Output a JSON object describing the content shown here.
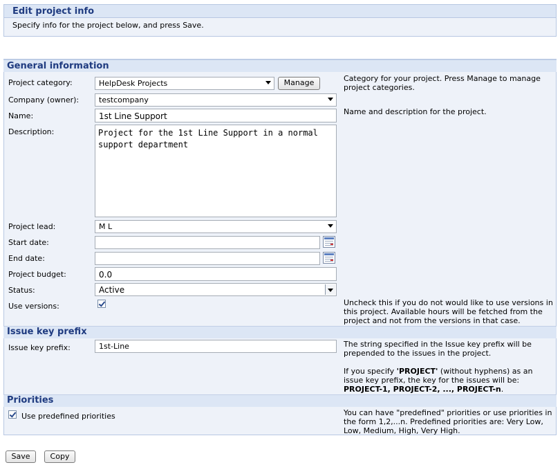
{
  "header": {
    "title": "Edit project info",
    "subtitle": "Specify info for the project below, and press Save."
  },
  "general": {
    "title": "General information",
    "project_category": {
      "label": "Project category:",
      "value": "HelpDesk Projects",
      "manage_label": "Manage"
    },
    "category_help": "Category for your project. Press Manage to manage project categories.",
    "company": {
      "label": "Company (owner):",
      "value": "testcompany"
    },
    "name": {
      "label": "Name:",
      "value": "1st Line Support"
    },
    "name_help": "Name and description for the project.",
    "description": {
      "label": "Description:",
      "value": "Project for the 1st Line Support in a normal support department"
    },
    "project_lead": {
      "label": "Project lead:",
      "value": "M L"
    },
    "start_date": {
      "label": "Start date:",
      "value": ""
    },
    "end_date": {
      "label": "End date:",
      "value": ""
    },
    "budget": {
      "label": "Project budget:",
      "value": "0.0"
    },
    "status": {
      "label": "Status:",
      "value": "Active"
    },
    "use_versions": {
      "label": "Use versions:",
      "checked": true
    },
    "versions_help": "Uncheck this if you do not would like to use versions in this project. Available hours will be fetched from the project and not from the versions in that case."
  },
  "issue_key": {
    "title": "Issue key prefix",
    "label": "Issue key prefix:",
    "value": "1st-Line",
    "help1": "The string specified in the Issue key prefix will be prepended to the issues in the project.",
    "help2_a": "If you specify ",
    "help2_b": "'PROJECT'",
    "help2_c": " (without hyphens) as an issue key prefix, the key for the issues will be:",
    "help2_d": "PROJECT-1, PROJECT-2, ..., PROJECT-n",
    "help2_e": "."
  },
  "priorities": {
    "title": "Priorities",
    "checkbox_label": "Use predefined priorities",
    "checked": true,
    "help": "You can have \"predefined\" priorities or use priorities in the form 1,2,...n. Predefined priorities are: Very Low, Low, Medium, High, Very High."
  },
  "footer": {
    "save_label": "Save",
    "copy_label": "Copy"
  }
}
